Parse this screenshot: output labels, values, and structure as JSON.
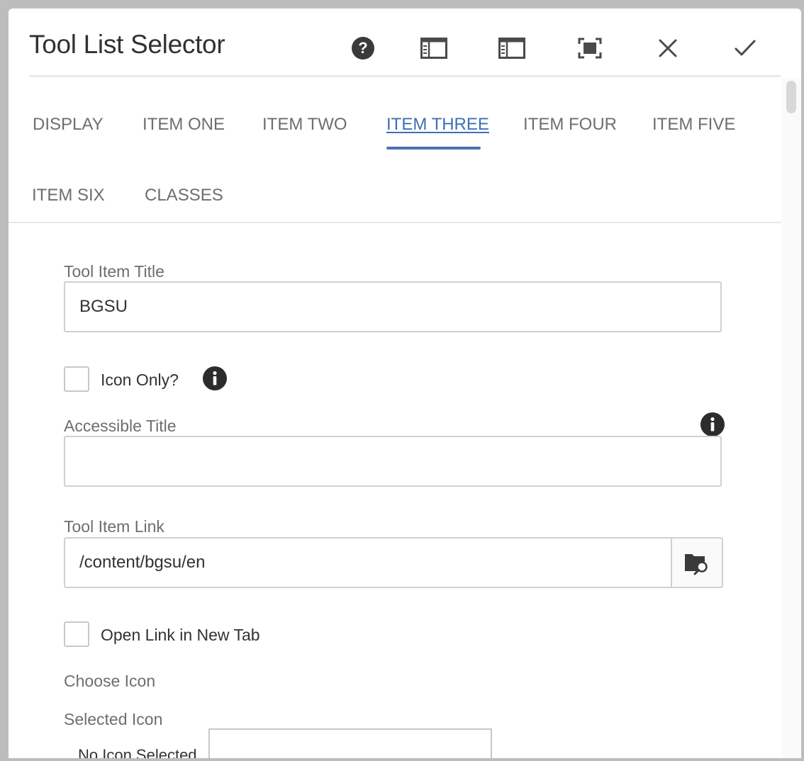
{
  "dialog": {
    "title": "Tool List Selector"
  },
  "toolbar": {
    "help": "help-icon",
    "panel_left": "panel-left-icon",
    "panel_left_alt": "panel-left-icon",
    "fullscreen": "fullscreen-icon",
    "close": "close-icon",
    "done": "check-icon"
  },
  "tabs": [
    {
      "label": "DISPLAY",
      "active": false
    },
    {
      "label": "ITEM ONE",
      "active": false
    },
    {
      "label": "ITEM TWO",
      "active": false
    },
    {
      "label": "ITEM THREE",
      "active": true
    },
    {
      "label": "ITEM FOUR",
      "active": false
    },
    {
      "label": "ITEM FIVE",
      "active": false
    },
    {
      "label": "ITEM SIX",
      "active": false
    },
    {
      "label": "CLASSES",
      "active": false
    }
  ],
  "form": {
    "tool_item_title": {
      "label": "Tool Item Title",
      "value": "BGSU"
    },
    "icon_only": {
      "label": "Icon Only?",
      "checked": false
    },
    "accessible_title": {
      "label": "Accessible Title",
      "value": ""
    },
    "tool_item_link": {
      "label": "Tool Item Link",
      "value": "/content/bgsu/en"
    },
    "open_new_tab": {
      "label": "Open Link in New Tab",
      "checked": false
    },
    "choose_icon": {
      "label": "Choose Icon"
    },
    "selected_icon": {
      "label": "Selected Icon",
      "empty_text": "No Icon Selected"
    }
  },
  "colors": {
    "accent": "#4b72b0",
    "text": "#323232",
    "muted": "#6e6e6e"
  }
}
